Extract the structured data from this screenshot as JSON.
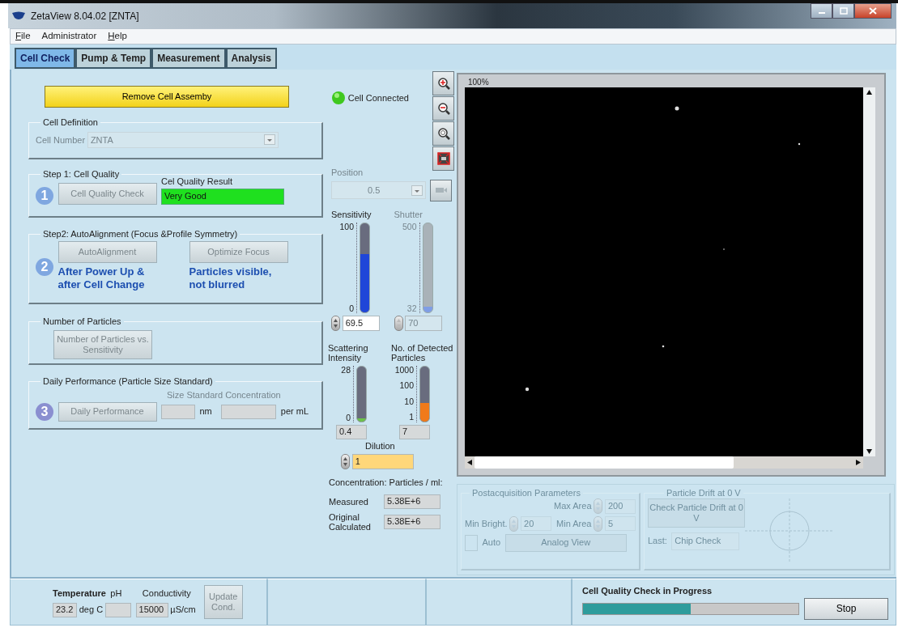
{
  "window": {
    "title": "ZetaView 8.04.02 [ZNTA]"
  },
  "menu": [
    {
      "label": "File",
      "underline_first": true
    },
    {
      "label": "Administrator",
      "underline_first": false
    },
    {
      "label": "Help",
      "underline_first": true
    }
  ],
  "tabs": [
    {
      "label": "Cell Check",
      "selected": true
    },
    {
      "label": "Pump & Temp",
      "selected": false
    },
    {
      "label": "Measurement",
      "selected": false
    },
    {
      "label": "Analysis",
      "selected": false
    }
  ],
  "remove_button": "Remove Cell Assemby",
  "cell_definition": {
    "title": "Cell Definition",
    "label": "Cell Number",
    "value": "ZNTA",
    "disabled": true
  },
  "step1": {
    "title": "Step 1: Cell Quality",
    "number": "1",
    "button": "Cell Quality Check",
    "disabled": true,
    "result_label": "Cel Quality Result",
    "result": "Very Good"
  },
  "step2": {
    "title": "Step2: AutoAlignment (Focus &Profile Symmetry)",
    "number": "2",
    "buttons": [
      {
        "label": "AutoAlignment",
        "disabled": true
      },
      {
        "label": "Optimize Focus",
        "disabled": true
      }
    ],
    "notes": [
      "After Power Up &\nafter Cell Change",
      "Particles visible,\nnot blurred"
    ]
  },
  "particles": {
    "title": "Number of Particles",
    "button": "Number of Particles vs. Sensitivity",
    "disabled": true
  },
  "daily": {
    "title": "Daily Performance (Particle Size Standard)",
    "number": "3",
    "button": "Daily Performance",
    "disabled": true,
    "conc_label": "Size Standard Concentration",
    "units": [
      "nm",
      "per mL"
    ]
  },
  "connection": {
    "label": "Cell Connected",
    "on": true
  },
  "position": {
    "label": "Position",
    "value": "0.5",
    "disabled": true
  },
  "meters": [
    {
      "label": "Sensitivity",
      "ticks": [
        "100",
        "0"
      ],
      "level": 0.65,
      "color": "#1f46d8",
      "value": "69.5",
      "kind": "spinner",
      "disabled": false
    },
    {
      "label": "Shutter",
      "ticks": [
        "500",
        "32"
      ],
      "level": 0.06,
      "color": "#7f9ee6",
      "value": "70",
      "kind": "spinner",
      "disabled": true
    },
    {
      "label": "Scattering Intensity",
      "ticks": [
        "28",
        "0"
      ],
      "level": 0.05,
      "color": "#6cc24a",
      "value": "0.4",
      "kind": "readout",
      "disabled": false
    },
    {
      "label": "No. of Detected Particles",
      "ticks": [
        "1000",
        "100",
        "10",
        "1"
      ],
      "level": 0.33,
      "color": "#f07a1a",
      "value": "7",
      "kind": "readout",
      "disabled": false
    }
  ],
  "dilution": {
    "label": "Dilution",
    "value": "1"
  },
  "concentration": {
    "title": "Concentration: Particles / ml:",
    "rows": [
      {
        "label": "Measured",
        "value": "5.38E+6"
      },
      {
        "label": "Original\nCalculated",
        "value": "5.38E+6"
      }
    ]
  },
  "viewer": {
    "zoom": "100%",
    "kind": "picture"
  },
  "postacquisition": {
    "title": "Postacquisition Parameters",
    "disabled": true,
    "fields": [
      {
        "label": "Max Area",
        "value": "200"
      },
      {
        "label": "Min Bright.",
        "value": "20"
      },
      {
        "label": "Min Area",
        "value": "5"
      }
    ],
    "auto": {
      "label": "Auto",
      "checked": false
    },
    "button": "Analog View"
  },
  "drift": {
    "title": "Particle Drift at 0 V",
    "button": "Check Particle Drift at 0 V",
    "last_label": "Last:",
    "last_value": "Chip Check"
  },
  "status_bar": {
    "temperature": {
      "label": "Temperature",
      "value": "23.2",
      "unit": "deg C"
    },
    "ph": {
      "label": "pH"
    },
    "conductivity": {
      "label": "Conductivity",
      "value": "15000",
      "unit": "µS/cm"
    },
    "update_button": {
      "label": "Update Cond.",
      "disabled": true
    },
    "progress": {
      "label": "Cell Quality Check in Progress",
      "level": 0.5
    },
    "stop_button": "Stop"
  }
}
